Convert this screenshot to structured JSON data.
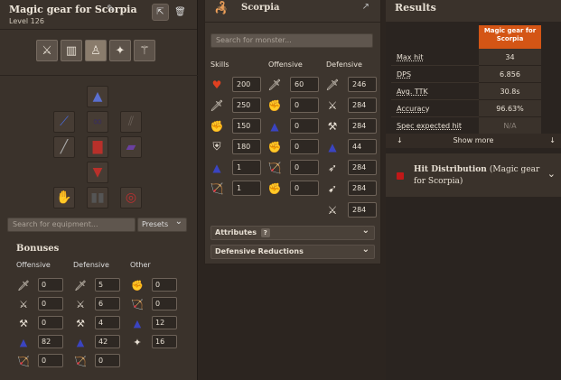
{
  "loadout": {
    "name": "Magic gear for Scorpia",
    "level": "Level 126"
  },
  "equipment": {
    "search_placeholder": "Search for equipment...",
    "presets_label": "Presets"
  },
  "bonuses": {
    "title": "Bonuses",
    "offensive_title": "Offensive",
    "defensive_title": "Defensive",
    "other_title": "Other",
    "offensive": [
      "0",
      "0",
      "0",
      "82",
      "0"
    ],
    "defensive": [
      "5",
      "6",
      "4",
      "42",
      "0"
    ],
    "other": [
      "0",
      "0",
      "12",
      "16"
    ]
  },
  "monster": {
    "name": "Scorpia",
    "search_placeholder": "Search for monster...",
    "skills_title": "Skills",
    "offensive_title": "Offensive",
    "defensive_title": "Defensive",
    "skills": [
      "200",
      "250",
      "150",
      "180",
      "1",
      "1"
    ],
    "offensive": [
      "60",
      "0",
      "0",
      "0",
      "0",
      "0"
    ],
    "defensive": [
      "246",
      "284",
      "284",
      "44",
      "284",
      "284",
      "284"
    ],
    "attributes_label": "Attributes",
    "attributes_help": "?",
    "defensive_reductions_label": "Defensive Reductions"
  },
  "results": {
    "title": "Results",
    "column_header": "Magic gear for Scorpia",
    "rows": [
      {
        "label": "Max hit",
        "value": "34"
      },
      {
        "label": "DPS",
        "value": "6.856"
      },
      {
        "label": "Avg. TTK",
        "value": "30.8s"
      },
      {
        "label": "Accuracy",
        "value": "96.63%"
      },
      {
        "label": "Spec expected hit",
        "value": "N/A"
      }
    ],
    "show_more": "Show more"
  },
  "hit_distribution": {
    "title": "Hit Distribution",
    "subtitle": "(Magic gear for Scorpia)"
  },
  "colors": {
    "accent": "#d45515",
    "panel": "#3a322b",
    "background": "#2a2420",
    "hit_marker": "#c01818"
  }
}
